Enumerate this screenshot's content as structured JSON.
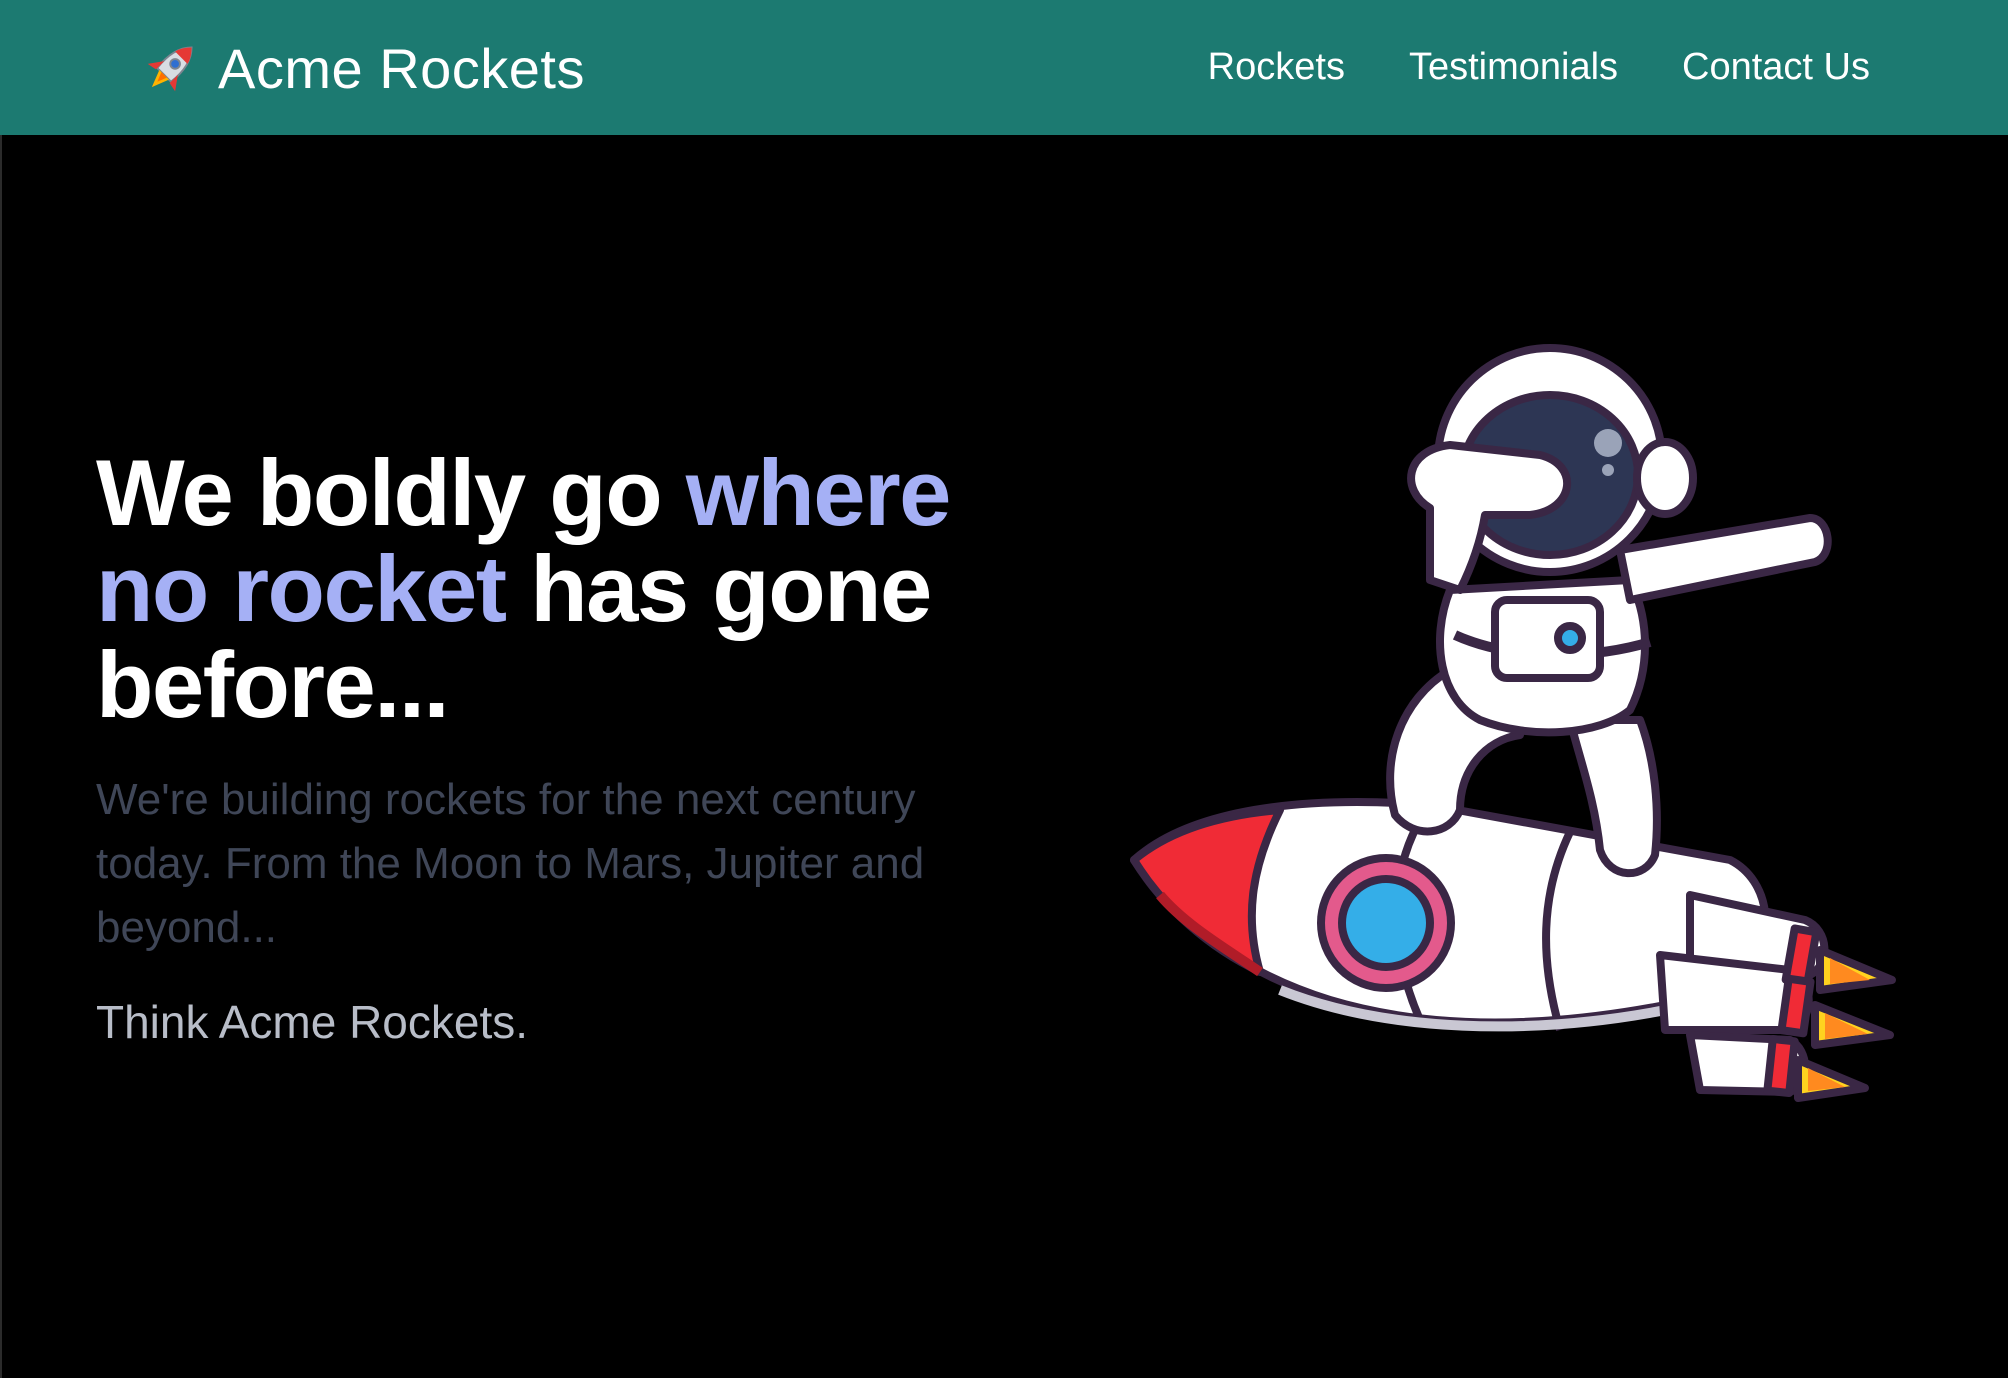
{
  "header": {
    "brand_name": "Acme Rockets",
    "brand_icon": "rocket-icon",
    "nav": [
      {
        "label": "Rockets"
      },
      {
        "label": "Testimonials"
      },
      {
        "label": "Contact Us"
      }
    ],
    "background_color": "#1c7a71"
  },
  "hero": {
    "title_part_1": "We boldly go ",
    "title_accent": "where no rocket",
    "title_part_2": " has gone before...",
    "subtitle": "We're building rockets for the next century today. From the Moon to Mars, Jupiter and beyond...",
    "tagline": "Think Acme Rockets.",
    "illustration": "astronaut-riding-rocket-illustration",
    "accent_color": "#a5b0f5",
    "background_color": "#000000"
  }
}
